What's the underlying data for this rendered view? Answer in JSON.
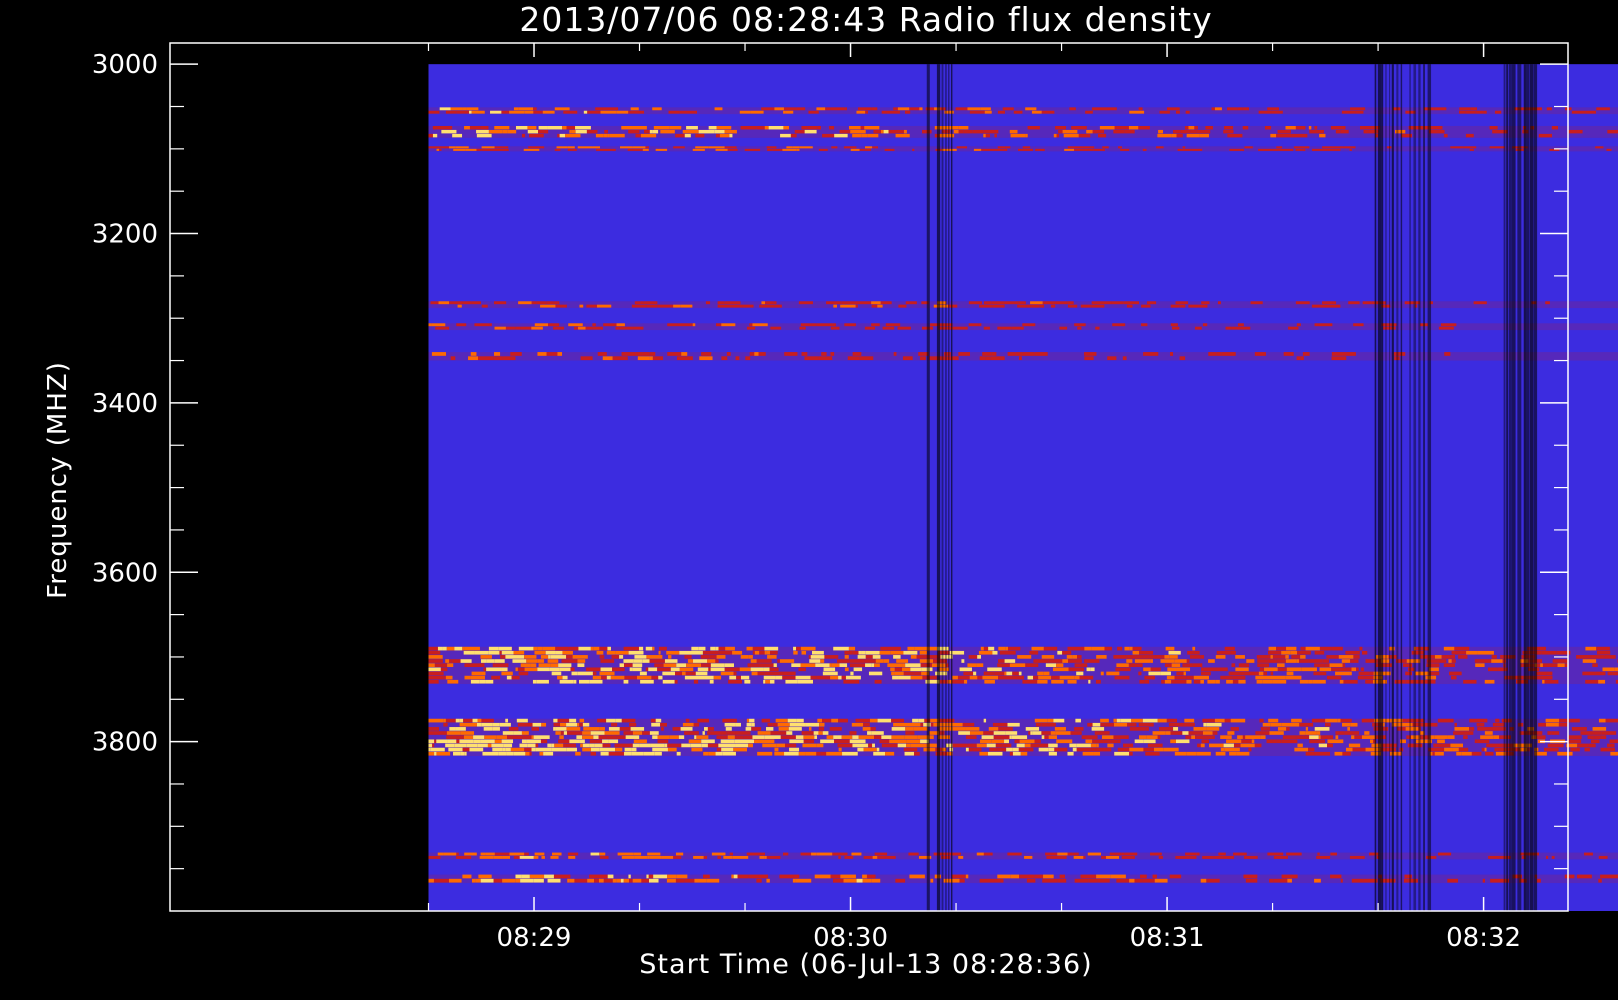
{
  "chart_data": {
    "type": "heatmap",
    "title": "2013/07/06 08:28:43 Radio flux density",
    "xlabel": "Start Time (06-Jul-13 08:28:36)",
    "ylabel": "Frequency (MHZ)",
    "x_tick_labels": [
      "08:29",
      "08:30",
      "08:31",
      "08:32"
    ],
    "x_tick_values_s": [
      24,
      84,
      144,
      204
    ],
    "xlim_s": [
      -45,
      220
    ],
    "data_time_range_s": [
      4,
      244
    ],
    "y_tick_labels": [
      "3000",
      "3200",
      "3400",
      "3600",
      "3800"
    ],
    "y_tick_values": [
      3000,
      3200,
      3400,
      3600,
      3800
    ],
    "ylim": [
      2975,
      4000
    ],
    "data_freq_range": [
      3000,
      4000
    ],
    "y_axis_inverted": true,
    "colormap": [
      "#000000",
      "#0000ff",
      "#5a28b4",
      "#c81e1e",
      "#ff6a00",
      "#ffe070"
    ],
    "background_color": "#3c2ce0",
    "emission_bands_mhz": [
      {
        "center": 3055,
        "width": 8,
        "intensity": 0.62
      },
      {
        "center": 3080,
        "width": 14,
        "intensity": 0.72
      },
      {
        "center": 3100,
        "width": 6,
        "intensity": 0.6
      },
      {
        "center": 3284,
        "width": 8,
        "intensity": 0.55
      },
      {
        "center": 3310,
        "width": 8,
        "intensity": 0.5
      },
      {
        "center": 3345,
        "width": 10,
        "intensity": 0.5
      },
      {
        "center": 3710,
        "width": 44,
        "intensity": 0.85
      },
      {
        "center": 3795,
        "width": 44,
        "intensity": 0.92
      },
      {
        "center": 3935,
        "width": 8,
        "intensity": 0.62
      },
      {
        "center": 3962,
        "width": 10,
        "intensity": 0.7
      }
    ],
    "dropout_periods_s": [
      {
        "t": [
          98,
          104
        ],
        "strength": 0.55
      },
      {
        "t": [
          182,
          194
        ],
        "strength": 0.7
      },
      {
        "t": [
          207,
          215
        ],
        "strength": 0.85
      }
    ]
  }
}
